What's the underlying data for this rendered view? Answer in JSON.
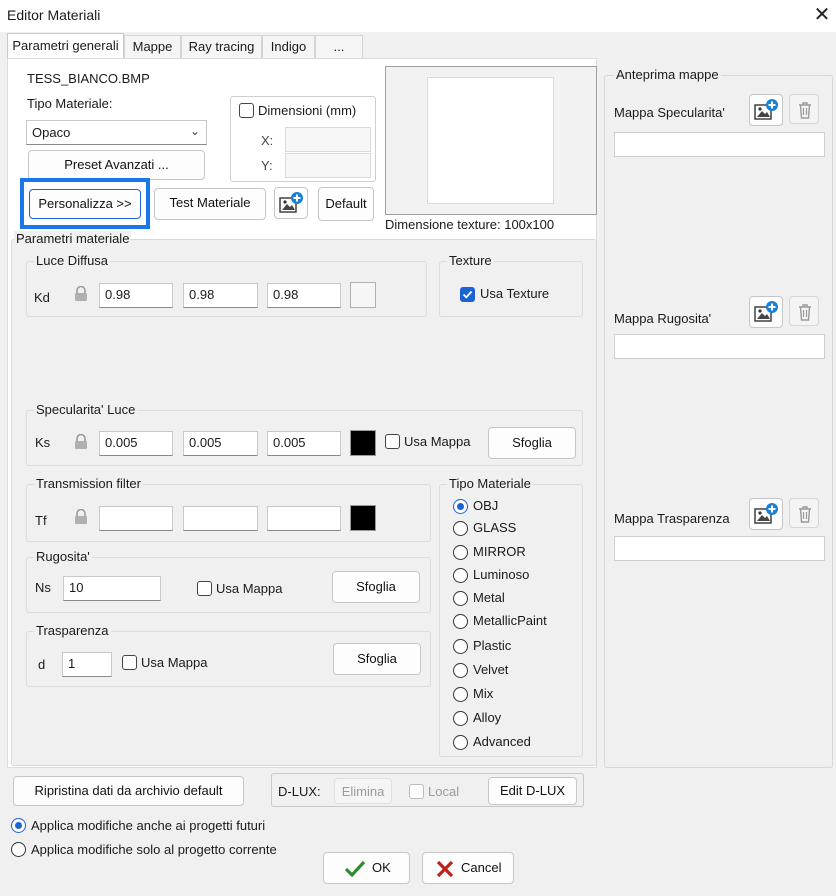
{
  "window": {
    "title": "Editor Materiali"
  },
  "tabs": [
    "Parametri generali",
    "Mappe",
    "Ray tracing",
    "Indigo",
    "..."
  ],
  "general": {
    "file_name": "TESS_BIANCO.BMP",
    "tipo_label": "Tipo Materiale:",
    "tipo_value": "Opaco",
    "dimensioni_label": "Dimensioni (mm)",
    "x_label": "X:",
    "y_label": "Y:",
    "preset_button": "Preset Avanzati ...",
    "personalizza_button": "Personalizza >>",
    "test_button": "Test Materiale",
    "default_button": "Default",
    "texture_dim": "Dimensione texture:  100x100"
  },
  "params": {
    "title": "Parametri materiale",
    "diffusa": {
      "title": "Luce Diffusa",
      "label": "Kd",
      "values": [
        "0.98",
        "0.98",
        "0.98"
      ],
      "color": "#f5f5f5"
    },
    "texture": {
      "title": "Texture",
      "check_label": "Usa Texture"
    },
    "specular": {
      "title": "Specularita' Luce",
      "label": "Ks",
      "values": [
        "0.005",
        "0.005",
        "0.005"
      ],
      "color": "#000000",
      "check_label": "Usa Mappa",
      "button": "Sfoglia"
    },
    "transmission": {
      "title": "Transmission filter",
      "label": "Tf",
      "color": "#000000"
    },
    "rugosita": {
      "title": "Rugosita'",
      "label": "Ns",
      "value": "10",
      "check_label": "Usa Mappa",
      "button": "Sfoglia"
    },
    "trasparenza": {
      "title": "Trasparenza",
      "label": "d",
      "value": "1",
      "check_label": "Usa Mappa",
      "button": "Sfoglia"
    },
    "tipo": {
      "title": "Tipo Materiale",
      "options": [
        "OBJ",
        "GLASS",
        "MIRROR",
        "Luminoso",
        "Metal",
        "MetallicPaint",
        "Plastic",
        "Velvet",
        "Mix",
        "Alloy",
        "Advanced"
      ],
      "selected": "OBJ"
    }
  },
  "maps": {
    "title": "Anteprima mappe",
    "items": [
      "Mappa Specularita'",
      "Mappa Rugosita'",
      "Mappa Trasparenza"
    ]
  },
  "bottom": {
    "ripristina": "Ripristina dati da archivio default",
    "dlux_label": "D-LUX:",
    "elimina": "Elimina",
    "local": "Local",
    "edit_dlux": "Edit D-LUX",
    "radio_future": "Applica modifiche anche ai progetti futuri",
    "radio_current": "Applica modifiche solo al progetto corrente",
    "ok": "OK",
    "cancel": "Cancel"
  },
  "colors": {
    "accent": "#1b63d4",
    "highlight": "#1878e8",
    "ok_check": "#2e8b2e",
    "cancel_x": "#c0201a"
  }
}
